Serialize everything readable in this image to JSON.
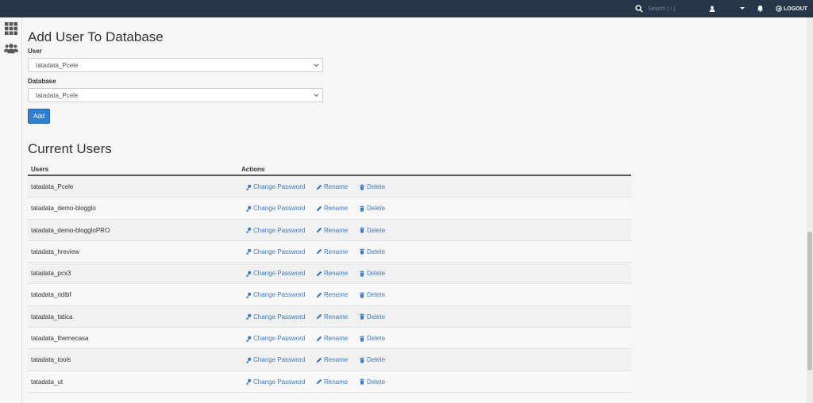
{
  "topbar": {
    "search_placeholder": "Search ( / )",
    "logout_label": "LOGOUT"
  },
  "page": {
    "title": "Add User To Database",
    "user_label": "User",
    "user_value": "tatadata_Pcele",
    "database_label": "Database",
    "database_value": "tatadata_Pcele",
    "add_label": "Add"
  },
  "current_users": {
    "title": "Current Users",
    "col_users": "Users",
    "col_actions": "Actions",
    "action_labels": {
      "change_password": "Change Password",
      "rename": "Rename",
      "delete": "Delete"
    },
    "rows": [
      "tatadata_Pcele",
      "tatadata_demo-blogglo",
      "tatadata_demo-bloggloPRO",
      "tatadata_hreview",
      "tatadata_pcx3",
      "tatadata_ridibf",
      "tatadata_tatica",
      "tatadata_themecasa",
      "tatadata_tools",
      "tatadata_ut"
    ]
  },
  "colors": {
    "topbar": "#263548",
    "link": "#3a7bc8",
    "primary_button": "#2f7fd1"
  },
  "icons": [
    "search-icon",
    "user-icon",
    "bell-icon",
    "logout-icon",
    "grid-icon",
    "users-group-icon",
    "key-icon",
    "pencil-icon",
    "trash-icon",
    "chevron-down-icon"
  ]
}
